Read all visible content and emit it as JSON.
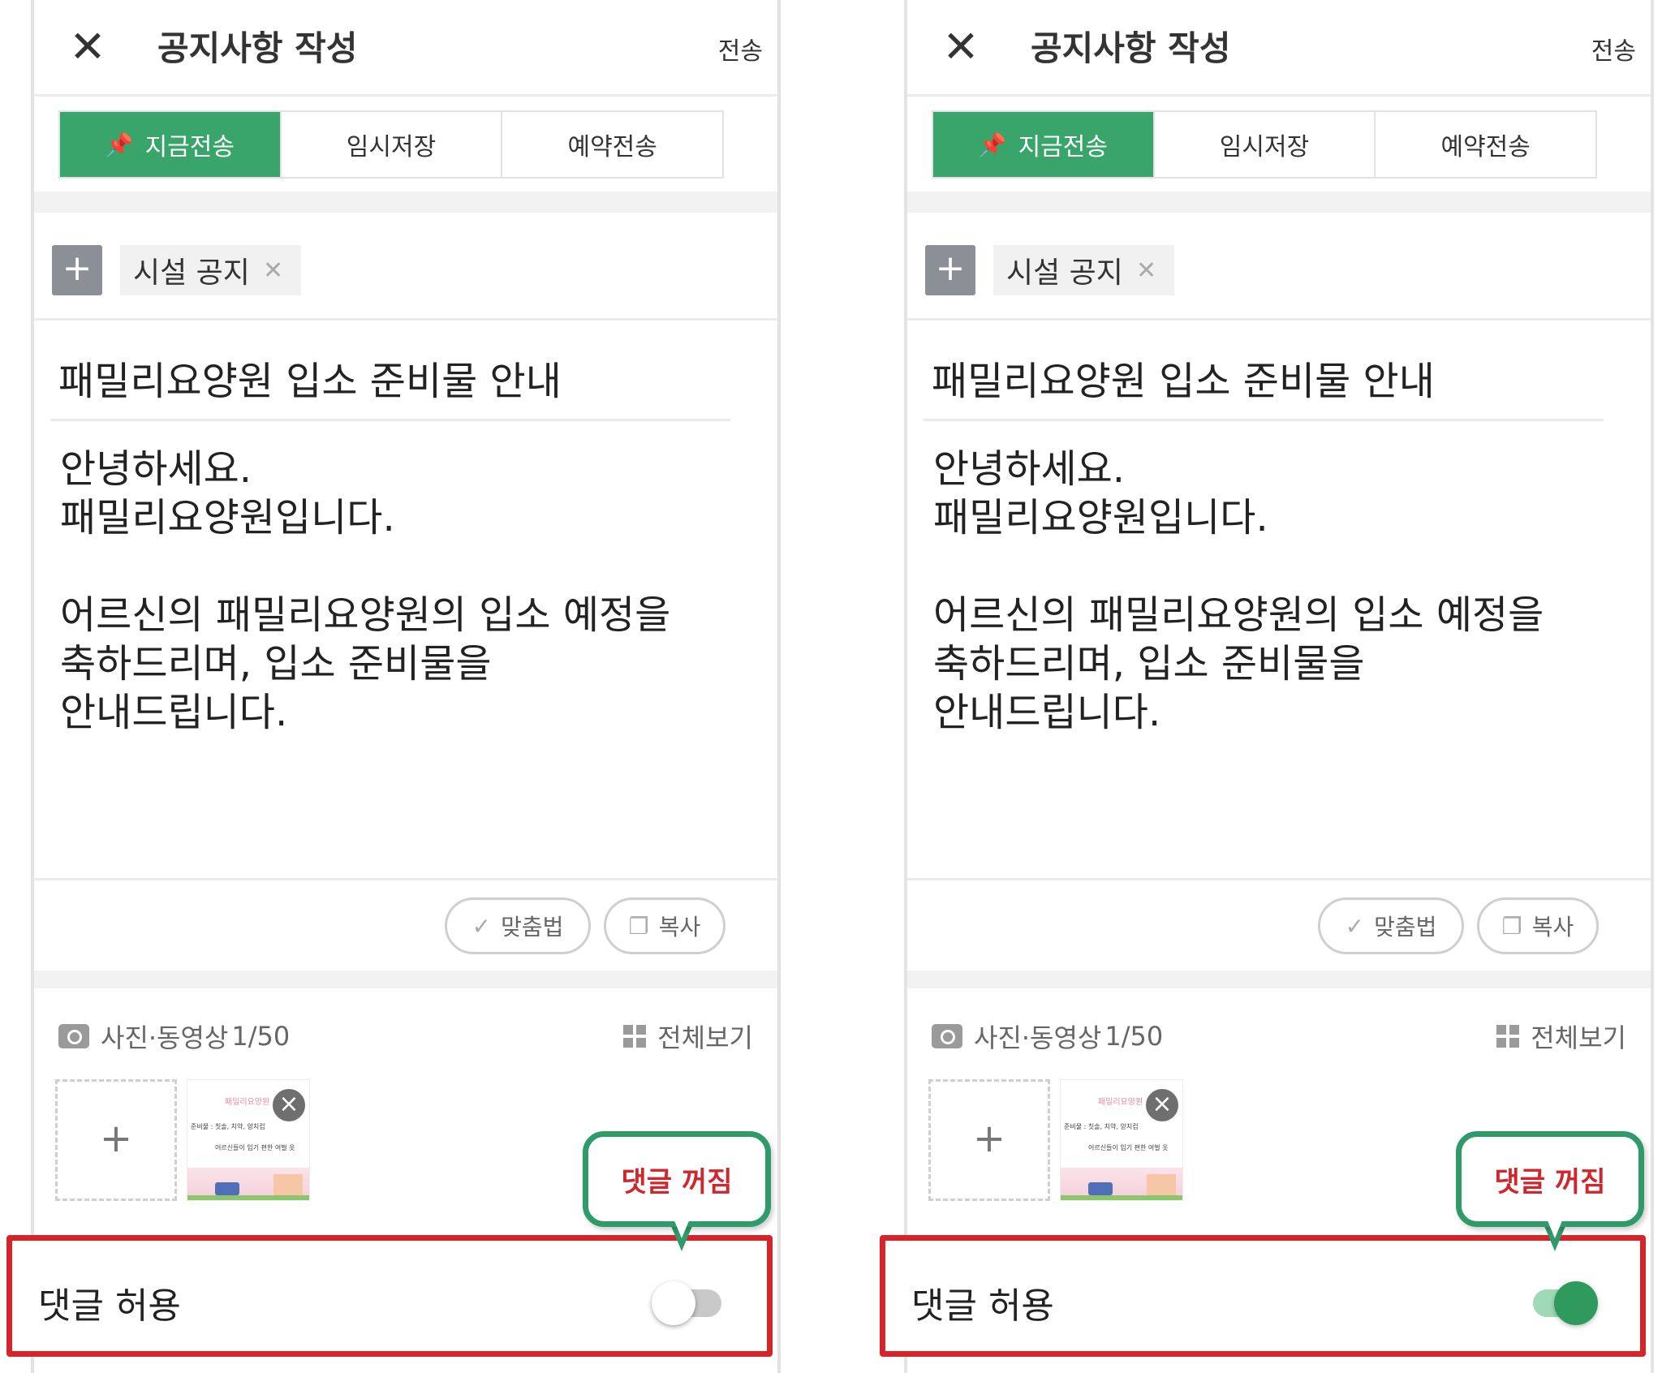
{
  "colors": {
    "accent_green": "#3aa56b",
    "highlight_red": "#d7232a",
    "callout_green": "#2f9a6a",
    "toggle_on": "#2f9a5c"
  },
  "panels": [
    {
      "header": {
        "title": "공지사항 작성",
        "send_label": "전송",
        "close_icon": "close-icon"
      },
      "tabs": [
        {
          "label": "지금전송",
          "active": true,
          "icon": "pin-icon"
        },
        {
          "label": "임시저장"
        },
        {
          "label": "예약전송"
        }
      ],
      "category": {
        "add_icon": "plus-icon",
        "chip_label": "시설 공지",
        "chip_remove_icon": "close-small-icon"
      },
      "subject": "패밀리요양원 입소 준비물 안내",
      "body": {
        "lines": [
          "안녕하세요.",
          "패밀리요양원입니다.",
          "",
          "어르신의 패밀리요양원의 입소 예정을",
          "축하드리며, 입소 준비물을",
          "안내드립니다."
        ]
      },
      "tools": {
        "spell_label": "맞춤법",
        "copy_label": "복사"
      },
      "media": {
        "label": "사진·동영상",
        "count": "1/50",
        "view_all": "전체보기",
        "add_symbol": "+",
        "thumb": {
          "title": "패밀리요양원",
          "line1": "준비물 : 칫솔, 치약, 양치컵",
          "line2": "어르신들이 입기 편한 여벌 옷"
        }
      },
      "comments": {
        "label": "댓글 허용",
        "enabled": false
      },
      "callout": {
        "text": "댓글 꺼짐"
      }
    },
    {
      "header": {
        "title": "공지사항 작성",
        "send_label": "전송",
        "close_icon": "close-icon"
      },
      "tabs": [
        {
          "label": "지금전송",
          "active": true,
          "icon": "pin-icon"
        },
        {
          "label": "임시저장"
        },
        {
          "label": "예약전송"
        }
      ],
      "category": {
        "add_icon": "plus-icon",
        "chip_label": "시설 공지",
        "chip_remove_icon": "close-small-icon"
      },
      "subject": "패밀리요양원 입소 준비물 안내",
      "body": {
        "lines": [
          "안녕하세요.",
          "패밀리요양원입니다.",
          "",
          "어르신의 패밀리요양원의 입소 예정을",
          "축하드리며, 입소 준비물을",
          "안내드립니다."
        ]
      },
      "tools": {
        "spell_label": "맞춤법",
        "copy_label": "복사"
      },
      "media": {
        "label": "사진·동영상",
        "count": "1/50",
        "view_all": "전체보기",
        "add_symbol": "+",
        "thumb": {
          "title": "패밀리요양원",
          "line1": "준비물 : 칫솔, 치약, 양치컵",
          "line2": "어르신들이 입기 편한 여벌 옷"
        }
      },
      "comments": {
        "label": "댓글 허용",
        "enabled": true
      },
      "callout": {
        "text": "댓글 꺼짐"
      }
    }
  ]
}
